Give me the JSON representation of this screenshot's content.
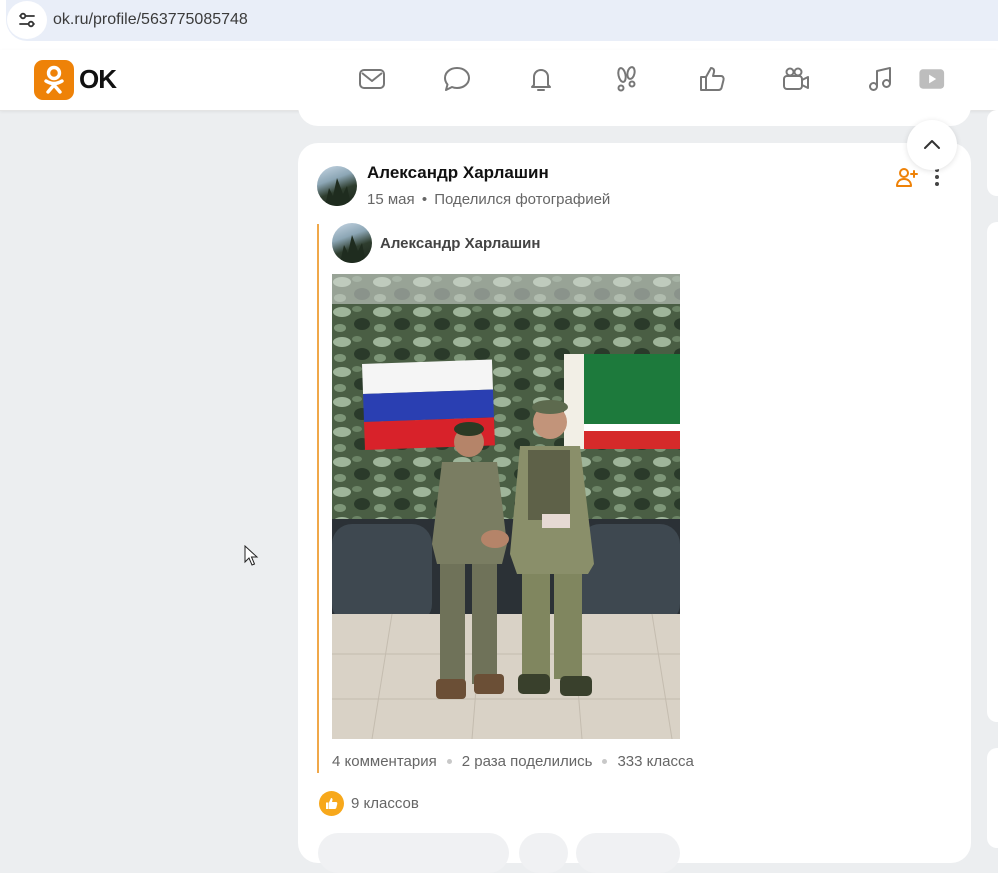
{
  "browser": {
    "url": "ok.ru/profile/563775085748",
    "site_info_icon": "tune-icon"
  },
  "header": {
    "logo_text": "OK",
    "brand_color": "#ee8208",
    "nav_icons": [
      "mail-icon",
      "chat-icon",
      "bell-icon",
      "footprints-icon",
      "thumbs-up-icon",
      "video-camera-icon",
      "music-icon",
      "video-play-icon"
    ]
  },
  "post": {
    "author": "Александр Харлашин",
    "date": "15 мая",
    "separator": "•",
    "action": "Поделился фотографией",
    "repost": {
      "author": "Александр Харлашин",
      "photo_icon": "photo"
    },
    "stats": {
      "comments": "4 комментария",
      "shares": "2 раза поделились",
      "classes": "333 класса"
    },
    "likes_label": "9 классов",
    "accent_color": "#f0a84a"
  }
}
